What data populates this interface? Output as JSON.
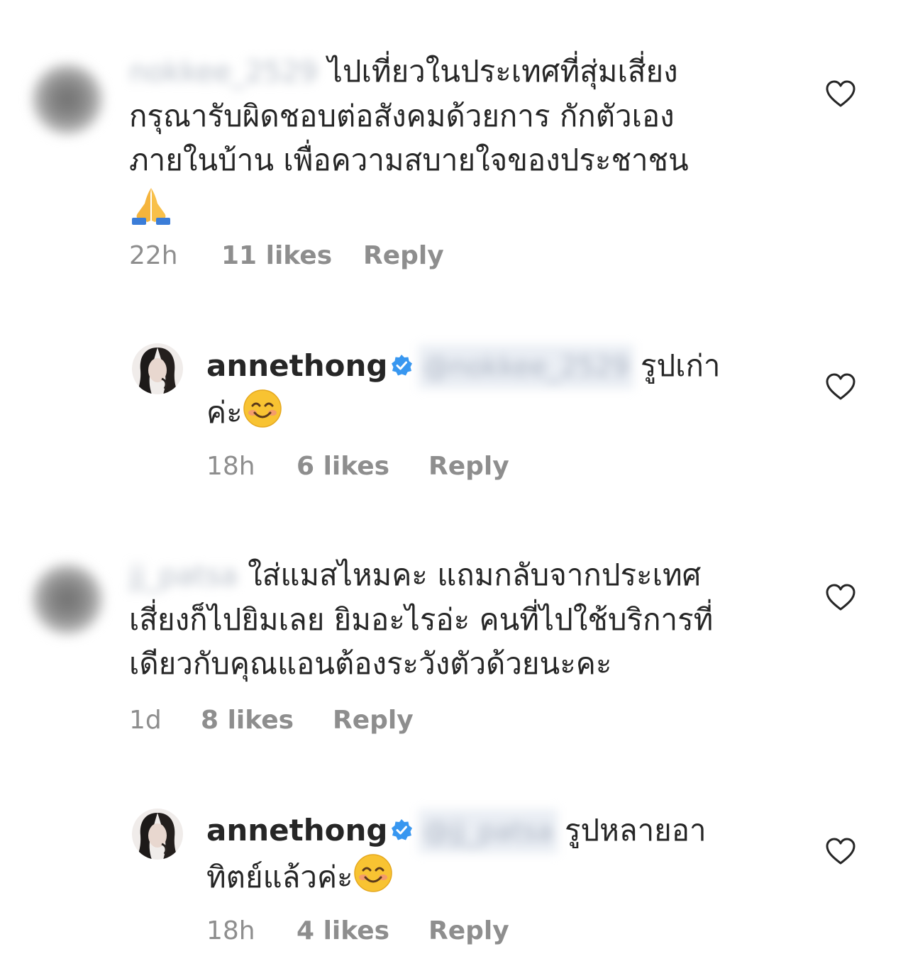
{
  "comments": [
    {
      "username_blurred": "nokkee_2529",
      "text_lines": [
        "ไปเที่ยวในประเทศที่สุ่มเสี่ยง",
        "กรุณารับผิดชอบต่อสังคมด้วยการ กักตัวเอง",
        "ภายในบ้าน เพื่อความสบายใจของประชาชน"
      ],
      "emoji": "folded-hands",
      "time": "22h",
      "likes": "11 likes",
      "reply": "Reply"
    },
    {
      "username": "annethong",
      "mention_blurred": "@nokkee_2529",
      "text_line1": "รูปเก่า",
      "text_line2": "ค่ะ",
      "emoji": "smiling-face",
      "time": "18h",
      "likes": "6 likes",
      "reply": "Reply"
    },
    {
      "username_blurred": "jj_patsa",
      "text_lines": [
        "ใส่แมสไหมคะ แถมกลับจากประเทศ",
        "เสี่ยงก็ไปยิมเลย ยิมอะไรอ่ะ คนที่ไปใช้บริการที่",
        "เดียวกับคุณแอนต้องระวังตัวด้วยนะคะ"
      ],
      "time": "1d",
      "likes": "8 likes",
      "reply": "Reply"
    },
    {
      "username": "annethong",
      "mention_blurred": "@jj_patsa",
      "text_line1": "รูปหลายอา",
      "text_line2": "ทิตย์แล้วค่ะ",
      "emoji": "smiling-face",
      "time": "18h",
      "likes": "4 likes",
      "reply": "Reply"
    }
  ],
  "colors": {
    "text": "#262626",
    "meta": "#8e8e8e",
    "verified": "#3897f0",
    "heart_stroke": "#262626"
  }
}
